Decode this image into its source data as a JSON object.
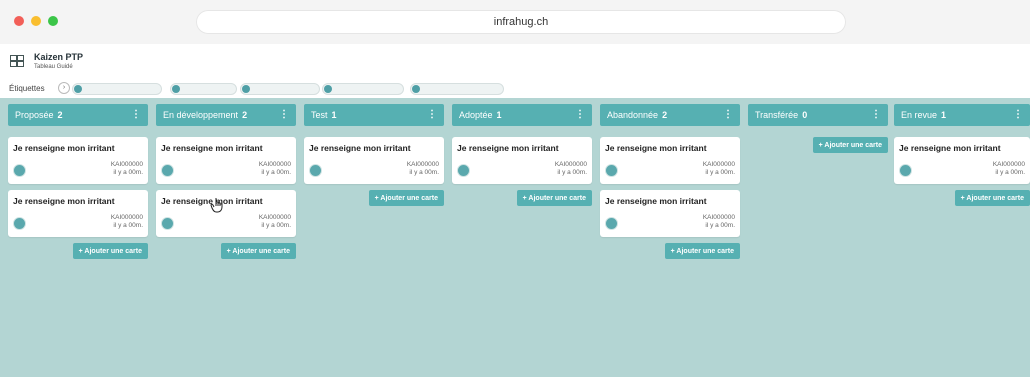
{
  "browser": {
    "url": "infrahug.ch"
  },
  "app": {
    "title": "Kaizen PTP",
    "subtitle": "Tableau Guidé"
  },
  "labels": {
    "text": "Étiquettes"
  },
  "columns": [
    {
      "title": "Proposée",
      "count": "2"
    },
    {
      "title": "En développement",
      "count": "2"
    },
    {
      "title": "Test",
      "count": "1"
    },
    {
      "title": "Adoptée",
      "count": "1"
    },
    {
      "title": "Abandonnée",
      "count": "2"
    },
    {
      "title": "Transférée",
      "count": "0"
    },
    {
      "title": "En revue",
      "count": "1"
    }
  ],
  "card": {
    "title": "Je renseigne mon irritant",
    "id": "KAI000000",
    "time": "il y a 00m."
  },
  "add_card_label": "+ Ajouter une carte",
  "colors": {
    "teal_header": "#56b0b2",
    "board_bg": "#b3d5d3",
    "avatar": "#5aa8ad"
  }
}
